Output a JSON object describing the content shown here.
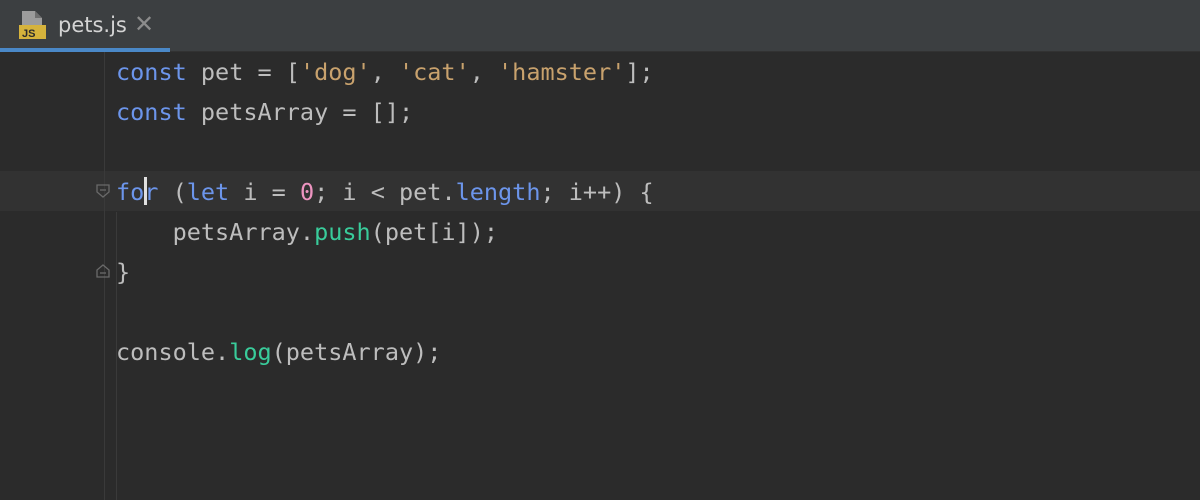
{
  "tab": {
    "file_name": "pets.js",
    "icon_text": "JS",
    "close_glyph": "✕"
  },
  "colors": {
    "background": "#2b2b2b",
    "tabbar": "#3c3f41",
    "active_tab_underline": "#4a88c7",
    "keyword": "#6c95eb",
    "string": "#c9a26d",
    "number": "#ed94c0",
    "function": "#39cc9b",
    "plain": "#bdbdbd"
  },
  "code": {
    "line1": {
      "kw": "const",
      "ident": " pet = [",
      "s1": "'dog'",
      "c1": ", ",
      "s2": "'cat'",
      "c2": ", ",
      "s3": "'hamster'",
      "end": "];"
    },
    "line2": {
      "kw": "const",
      "rest": " petsArray = [];"
    },
    "line4": {
      "kw_for": "for",
      "p1": " (",
      "kw_let": "let",
      "p2": " i = ",
      "num": "0",
      "p3": "; i < pet.",
      "prop": "length",
      "p4": "; i++) {"
    },
    "line5": {
      "indent": "    petsArray.",
      "fn": "push",
      "rest": "(pet[i]);"
    },
    "line6": {
      "text": "}"
    },
    "line8": {
      "obj": "console.",
      "fn": "log",
      "rest": "(petsArray);"
    }
  }
}
